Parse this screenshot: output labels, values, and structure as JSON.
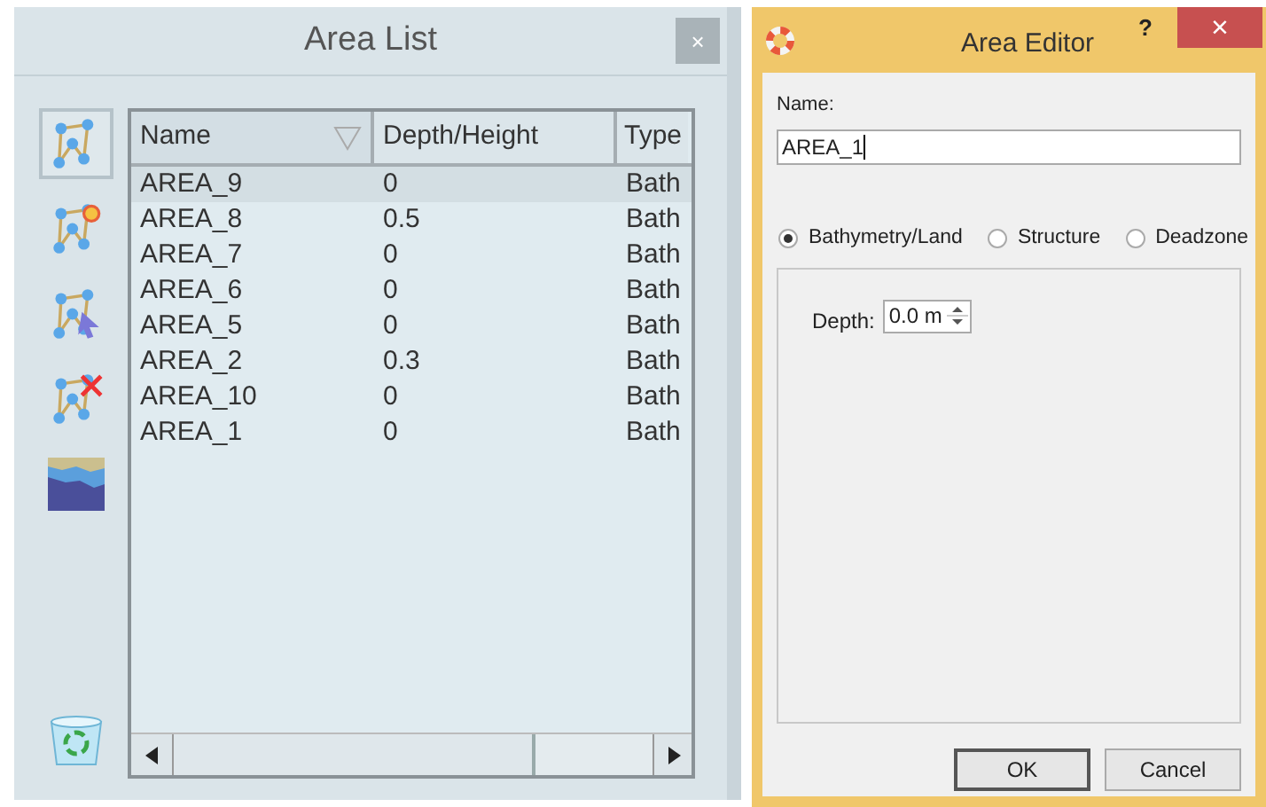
{
  "area_list": {
    "title": "Area List",
    "close": "×",
    "tools": [
      {
        "kind": "polygon",
        "selected": true
      },
      {
        "kind": "add",
        "selected": false
      },
      {
        "kind": "select",
        "selected": false
      },
      {
        "kind": "delete",
        "selected": false
      },
      {
        "kind": "bathymetry",
        "selected": false
      },
      {
        "kind": "recycle",
        "selected": false
      }
    ],
    "table": {
      "columns": [
        {
          "label": "Name",
          "sorted": true
        },
        {
          "label": "Depth/Height",
          "sorted": false
        },
        {
          "label": "Type",
          "sorted": false
        }
      ],
      "rows": [
        {
          "cells": [
            "AREA_9",
            "0",
            "Bath"
          ],
          "selected": true
        },
        {
          "cells": [
            "AREA_8",
            "0.5",
            "Bath"
          ],
          "selected": false
        },
        {
          "cells": [
            "AREA_7",
            "0",
            "Bath"
          ],
          "selected": false
        },
        {
          "cells": [
            "AREA_6",
            "0",
            "Bath"
          ],
          "selected": false
        },
        {
          "cells": [
            "AREA_5",
            "0",
            "Bath"
          ],
          "selected": false
        },
        {
          "cells": [
            "AREA_2",
            "0.3",
            "Bath"
          ],
          "selected": false
        },
        {
          "cells": [
            "AREA_10",
            "0",
            "Bath"
          ],
          "selected": false
        },
        {
          "cells": [
            "AREA_1",
            "0",
            "Bath"
          ],
          "selected": false
        }
      ]
    }
  },
  "area_editor": {
    "title": "Area Editor",
    "help": "?",
    "close": "×",
    "name_label": "Name:",
    "name_value": "AREA_1",
    "types": [
      {
        "label": "Bathymetry/Land",
        "selected": true
      },
      {
        "label": "Structure",
        "selected": false
      },
      {
        "label": "Deadzone",
        "selected": false
      }
    ],
    "depth_label": "Depth:",
    "depth_value": "0.0 m",
    "buttons": [
      {
        "label": "OK",
        "default": true
      },
      {
        "label": "Cancel",
        "default": false
      }
    ]
  }
}
